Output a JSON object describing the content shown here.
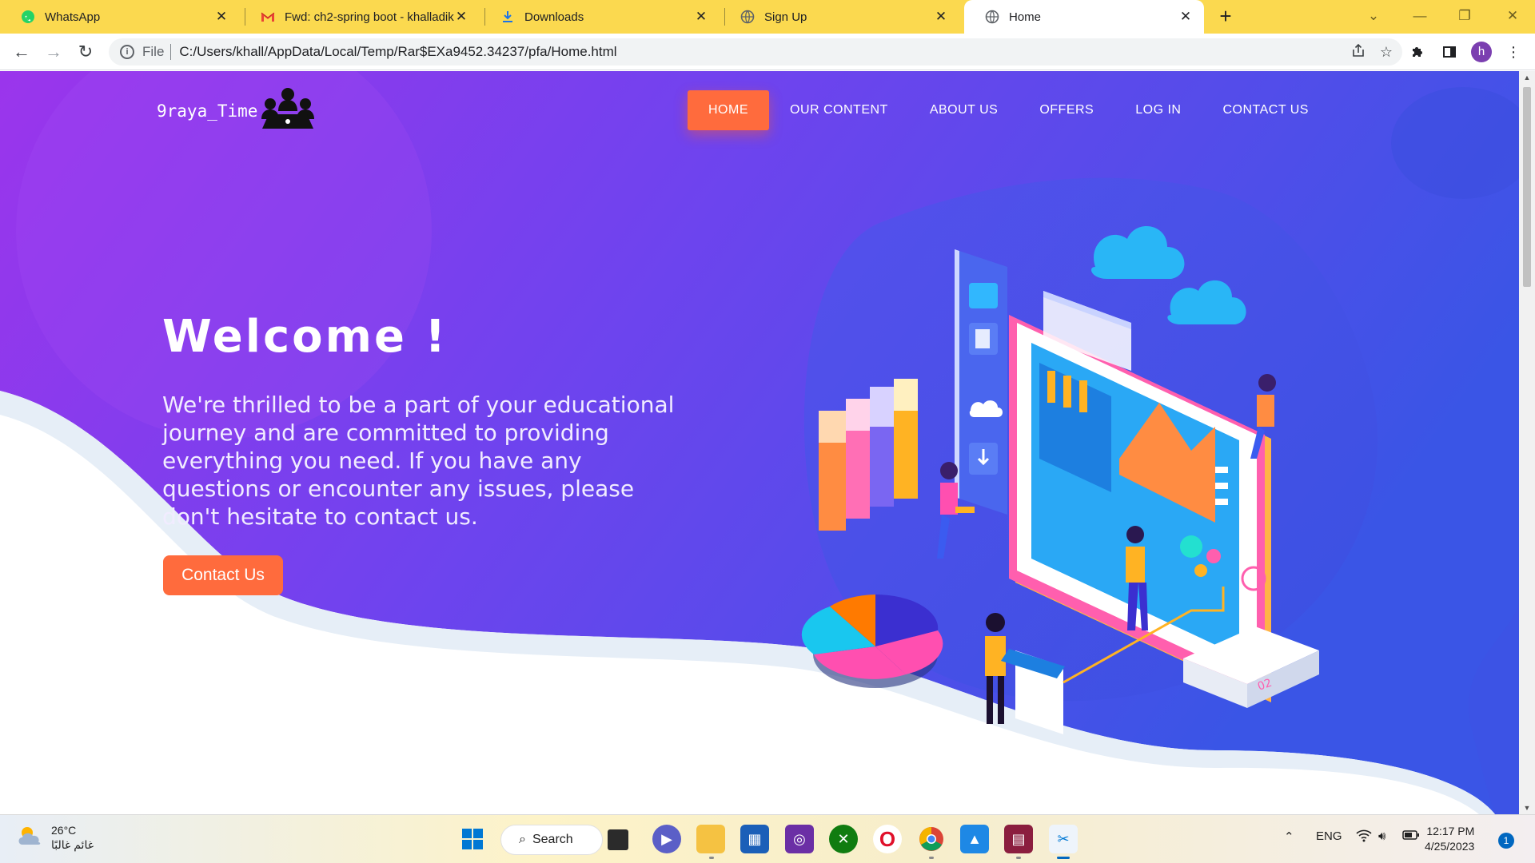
{
  "browser": {
    "tabs": [
      {
        "title": "WhatsApp",
        "icon": "whatsapp-icon"
      },
      {
        "title": "Fwd: ch2-spring boot - khalladik",
        "icon": "gmail-icon"
      },
      {
        "title": "Downloads",
        "icon": "download-icon"
      },
      {
        "title": "Sign Up",
        "icon": "globe-icon"
      },
      {
        "title": "Home",
        "icon": "globe-icon",
        "active": true
      }
    ],
    "new_tab": "+",
    "address": {
      "scheme_label": "File",
      "url": "C:/Users/khall/AppData/Local/Temp/Rar$EXa9452.34237/pfa/Home.html"
    },
    "profile_initial": "h"
  },
  "page": {
    "logo_text": "9raya_Time",
    "nav": [
      "HOME",
      "OUR CONTENT",
      "ABOUT US",
      "OFFERS",
      "LOG IN",
      "CONTACT US"
    ],
    "active_nav": "HOME",
    "hero": {
      "title": "Welcome !",
      "text": "We're thrilled to be a part of your educational journey and are committed to providing everything you need. If you have any questions or encounter any issues, please don't hesitate to contact us.",
      "button": "Contact Us"
    },
    "colors": {
      "gradient_start": "#9b35ec",
      "gradient_end": "#3a55e6",
      "accent": "#ff6b3d"
    }
  },
  "taskbar": {
    "weather": {
      "temp": "26°C",
      "condition": "غائم غالبًا"
    },
    "search_label": "Search",
    "tray": {
      "language": "ENG",
      "time": "12:17 PM",
      "date": "4/25/2023",
      "notifications": "1"
    }
  }
}
